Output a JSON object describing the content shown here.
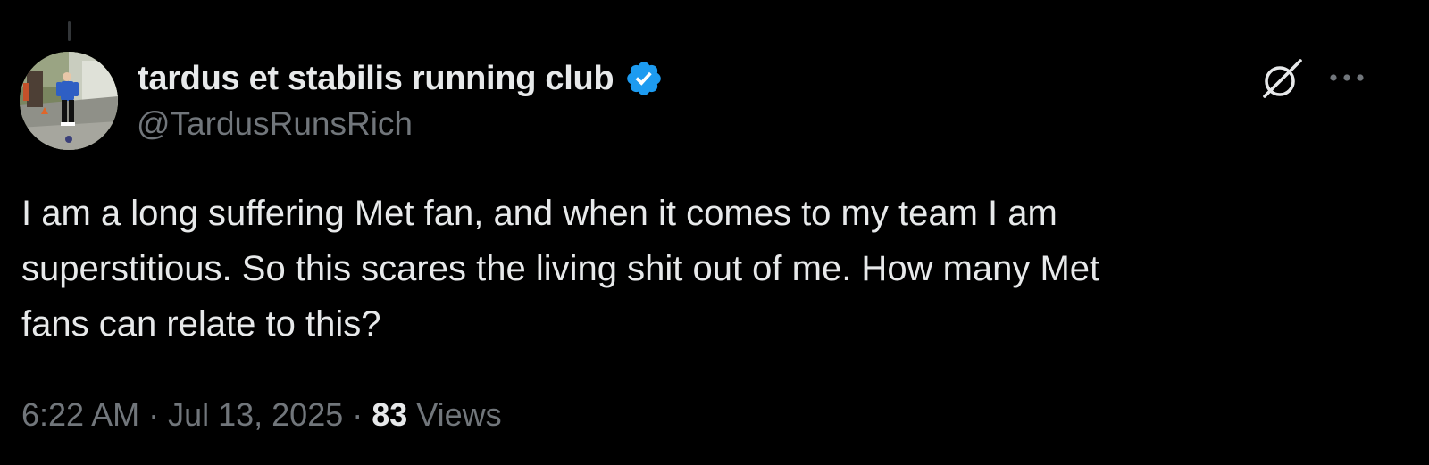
{
  "author": {
    "display_name": "tardus et stabilis running club",
    "handle": "@TardusRunsRich",
    "verified": true
  },
  "tweet": {
    "text": "I am a long suffering Met fan, and when it comes to my team I am\nsuperstitious.  So this scares the living shit out of me.  How many Met\nfans can relate to this?"
  },
  "meta": {
    "time": "6:22 AM",
    "separator": " · ",
    "date": "Jul 13, 2025",
    "views_count": "83",
    "views_label": " Views"
  },
  "icons": {
    "grok": "grok-icon",
    "more": "more-options-icon",
    "verified": "verified-badge-icon"
  },
  "colors": {
    "background": "#000000",
    "primary_text": "#e7e9ea",
    "secondary_text": "#71767b",
    "verified_blue": "#1d9bf0"
  }
}
